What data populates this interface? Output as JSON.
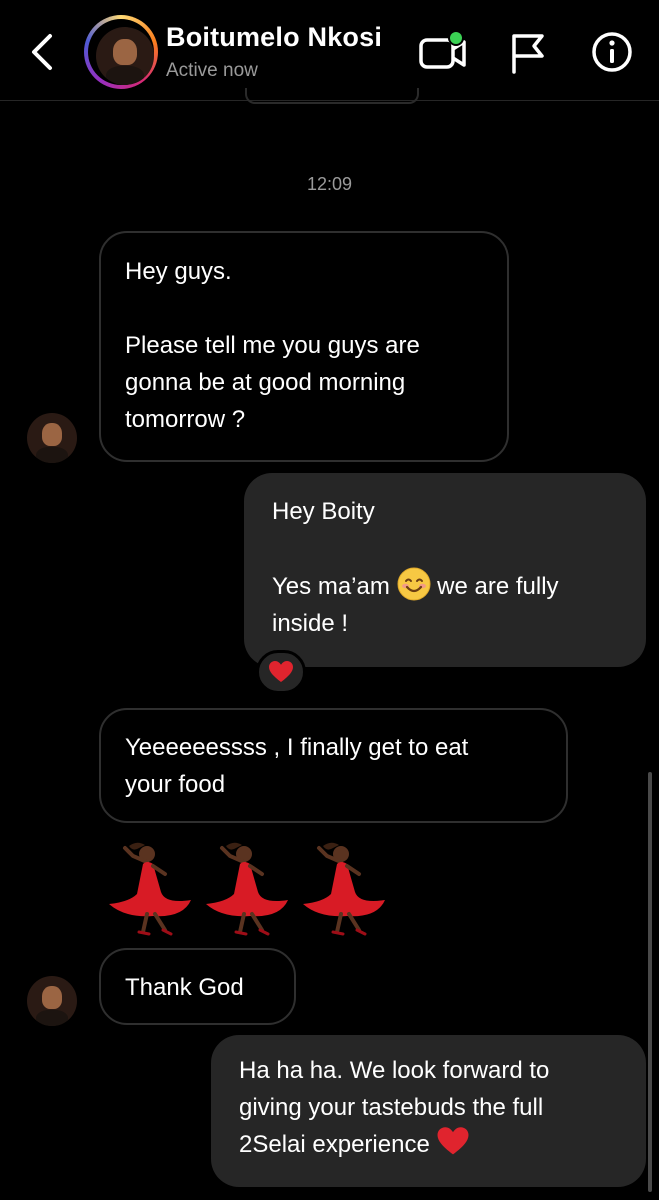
{
  "header": {
    "name": "Boitumelo Nkosi",
    "status": "Active now",
    "icons": [
      "back-chevron-icon",
      "video-call-icon",
      "flag-icon",
      "info-icon"
    ],
    "online_color": "#3bd154"
  },
  "thread": {
    "timestamp": "12:09",
    "messages": [
      {
        "from": "them",
        "text": "Hey guys.\n\nPlease tell me you guys are\ngonna be at good morning\ntomorrow ?"
      },
      {
        "from": "me",
        "text_before_emoji": "Hey Boity\n\nYes ma’am ",
        "emoji": "smiling-face-emoji",
        "text_after_emoji": "  we are fully\ninside !",
        "reaction": "red-heart"
      },
      {
        "from": "them",
        "text": "Yeeeeeessss , I finally get to eat\nyour food"
      },
      {
        "from": "them",
        "emoji_message": [
          "woman-dancing",
          "woman-dancing",
          "woman-dancing"
        ]
      },
      {
        "from": "them",
        "text": "Thank God"
      },
      {
        "from": "me",
        "text": "Ha ha ha. We look forward to\ngiving your tastebuds the full\n2Selai experience ",
        "emoji": "red-heart"
      }
    ]
  },
  "colors": {
    "background": "#000000",
    "outgoing_bubble": "#262626",
    "incoming_border": "#2f2f2f",
    "secondary_text": "#9a9a9a",
    "heart": "#e0242e"
  }
}
